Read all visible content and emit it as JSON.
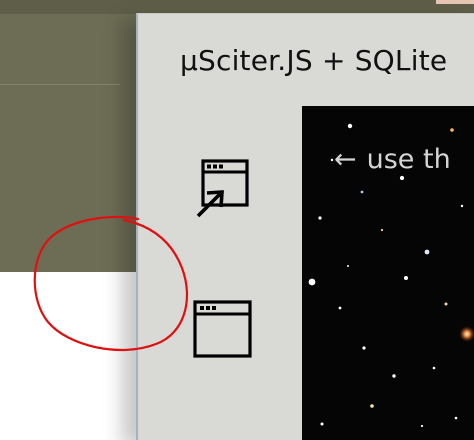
{
  "window": {
    "title": "µSciter.JS + SQLite"
  },
  "sidebar": {
    "items": [
      {
        "icon": "window-shortcut-icon"
      },
      {
        "icon": "window-icon"
      }
    ]
  },
  "content": {
    "hint_arrow": "←",
    "hint_text": "use th"
  },
  "colors": {
    "annotation": "#e01010",
    "background": "#6d6d55",
    "window": "#d9d9d6",
    "content": "#050505"
  }
}
